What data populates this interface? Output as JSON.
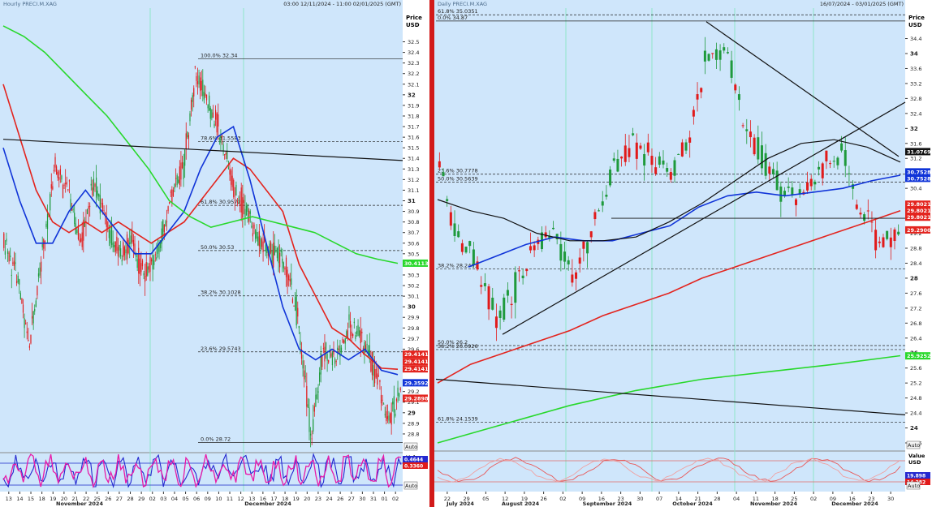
{
  "colors": {
    "bg": "#cfe6fb",
    "axis_bg": "#ffffff",
    "grid": "#8fe5c9",
    "up": "#1f9a3c",
    "down": "#e11a1a",
    "ma_blue": "#1034d8",
    "ma_red": "#e3241e",
    "ma_green": "#28d82b",
    "ma_black": "#111111",
    "ind_blue": "#2428d0",
    "ind_pink": "#e81aa8",
    "stoch": "#e87a7a"
  },
  "left": {
    "title": "Hourly PRECI.M.XAG",
    "time_range": "03:00 12/11/2024 - 11:00 02/01/2025 (GMT)",
    "price_header": [
      "Price",
      "USD"
    ],
    "y_ticks": [
      "32.5",
      "32.4",
      "32.3",
      "32.2",
      "32.1",
      "32",
      "31.9",
      "31.8",
      "31.7",
      "31.6",
      "31.5",
      "31.4",
      "31.3",
      "31.2",
      "31.1",
      "31",
      "30.9",
      "30.8",
      "30.7",
      "30.6",
      "30.5",
      "30.4",
      "30.3",
      "30.2",
      "30.1",
      "30",
      "29.9",
      "29.8",
      "29.7",
      "29.6",
      "29.5",
      "29.4",
      "29.3",
      "29.2",
      "29.1",
      "29",
      "28.9",
      "28.8"
    ],
    "fib_levels": [
      {
        "label": "100.0% 32.34",
        "value": 32.34
      },
      {
        "label": "78.6% 31.5583",
        "value": 31.5583
      },
      {
        "label": "61.8% 30.9572",
        "value": 30.9572
      },
      {
        "label": "50.0% 30.53",
        "value": 30.53
      },
      {
        "label": "38.2% 30.1028",
        "value": 30.1028
      },
      {
        "label": "23.6% 29.5743",
        "value": 29.5743
      },
      {
        "label": "0.0% 28.72",
        "value": 28.72
      }
    ],
    "badges": [
      {
        "text": "30.4113",
        "value": 30.4113,
        "color": "#28d82b"
      },
      {
        "text": "29.4141",
        "value": 29.4141,
        "color": "#e3241e"
      },
      {
        "text": "29.4141",
        "value": 29.4141,
        "color": "#e3241e"
      },
      {
        "text": "29.4141",
        "value": 29.4141,
        "color": "#e3241e"
      },
      {
        "text": "29.3592",
        "value": 29.3592,
        "color": "#1034d8"
      },
      {
        "text": "29.2898",
        "value": 29.2898,
        "color": "#e3241e"
      }
    ],
    "indicator": {
      "header": [
        "Value",
        "USD"
      ],
      "badges": [
        "0.4644",
        "0.3360"
      ],
      "auto_label": "Auto"
    },
    "auto_label": "Auto",
    "x_day_labels": [
      "13",
      "14",
      "15",
      "18",
      "19",
      "20",
      "21",
      "22",
      "25",
      "26",
      "27",
      "28",
      "29",
      "02",
      "03",
      "04",
      "05",
      "06",
      "09",
      "10",
      "11",
      "12",
      "13",
      "16",
      "17",
      "18",
      "19",
      "20",
      "23",
      "24",
      "26",
      "27",
      "30",
      "31",
      "01",
      "02"
    ],
    "x_month_labels": [
      "November 2024",
      "December 2024"
    ]
  },
  "right": {
    "title": "Daily PRECI.M.XAG",
    "time_range": "16/07/2024 - 03/01/2025 (GMT)",
    "price_header": [
      "Price",
      "USD"
    ],
    "y_ticks": [
      "34.4",
      "34",
      "33.6",
      "33.2",
      "32.8",
      "32.4",
      "32",
      "31.6",
      "31.2",
      "30.8",
      "30.4",
      "30",
      "29.6",
      "29.2",
      "28.8",
      "28.4",
      "28",
      "27.6",
      "27.2",
      "26.8",
      "26.4",
      "26",
      "25.6",
      "25.2",
      "24.8",
      "24.4",
      "24",
      "23.6"
    ],
    "fib_levels": [
      {
        "label": "61.8% 35.0351",
        "value": 35.0351
      },
      {
        "label": "0.0% 34.87",
        "value": 34.87
      },
      {
        "label": "23.6% 30.7778",
        "value": 30.7778
      },
      {
        "label": "50.0% 30.5639",
        "value": 30.5639
      },
      {
        "label": "38.2% 28.2461",
        "value": 28.2461
      },
      {
        "label": "50.0% 26.2",
        "value": 26.2
      },
      {
        "label": "38.2% 26.0926",
        "value": 26.0926
      },
      {
        "label": "61.8% 24.1539",
        "value": 24.1539
      }
    ],
    "badges": [
      {
        "text": "31.0769",
        "value": 31.0769,
        "color": "#111111"
      },
      {
        "text": "30.7528",
        "value": 30.7528,
        "color": "#1034d8"
      },
      {
        "text": "30.7528",
        "value": 30.7528,
        "color": "#1034d8"
      },
      {
        "text": "29.8021",
        "value": 29.8021,
        "color": "#e3241e"
      },
      {
        "text": "29.8021",
        "value": 29.8021,
        "color": "#e3241e"
      },
      {
        "text": "29.8021",
        "value": 29.8021,
        "color": "#e3241e"
      },
      {
        "text": "29.2900",
        "value": 29.29,
        "color": "#e3241e"
      },
      {
        "text": "25.9252",
        "value": 25.9252,
        "color": "#28d82b"
      }
    ],
    "indicator": {
      "header": [
        "Value",
        "USD"
      ],
      "badges": [
        "19.898",
        "14.382"
      ],
      "auto_label": "Auto"
    },
    "auto_label": "Auto",
    "x_day_labels": [
      "22",
      "29",
      "05",
      "12",
      "19",
      "26",
      "02",
      "09",
      "16",
      "23",
      "30",
      "07",
      "14",
      "21",
      "28",
      "04",
      "11",
      "18",
      "25",
      "02",
      "09",
      "16",
      "23",
      "30"
    ],
    "x_month_labels": [
      "July 2024",
      "August 2024",
      "September 2024",
      "October 2024",
      "November 2024",
      "December 2024"
    ]
  },
  "chart_data": [
    {
      "type": "line",
      "title": "Hourly PRECI.M.XAG",
      "ylabel": "Price USD",
      "ylim": [
        28.7,
        32.6
      ],
      "x_range": [
        "13 Nov 2024",
        "02 Jan 2025"
      ],
      "series": [
        {
          "values": [
            31.0,
            30.4,
            29.7,
            30.6,
            31.4,
            31.2,
            30.6,
            31.2,
            30.9,
            30.6,
            30.5,
            30.3,
            30.6,
            30.9,
            31.3,
            32.3,
            31.8,
            31.7,
            31.2,
            30.9,
            30.7,
            30.5,
            30.3,
            29.1,
            28.8,
            29.7,
            29.5,
            29.8,
            29.7,
            29.3,
            28.9,
            29.2
          ]
        },
        {
          "values": [
            30.5,
            30.7,
            30.9,
            31.0,
            31.0,
            30.9,
            30.7,
            30.5,
            30.5,
            30.6,
            30.9,
            31.4,
            31.7,
            31.5,
            30.9,
            30.1,
            29.6,
            29.5,
            29.4,
            29.4,
            29.4,
            29.36
          ]
        },
        {
          "values": [
            31.0,
            30.8,
            30.8,
            30.7,
            30.6,
            30.6,
            30.7,
            31.0,
            31.3,
            31.4,
            31.3,
            31.1,
            30.8,
            30.4,
            30.0,
            29.8,
            29.6,
            29.5,
            29.41
          ]
        },
        {
          "values": [
            31.8,
            31.7,
            31.4,
            31.0,
            30.8,
            30.7,
            30.6,
            30.53,
            30.45,
            30.41
          ]
        }
      ],
      "indicator": {
        "type": "line",
        "ylabel": "Value USD",
        "values": [
          0.4644,
          0.336
        ]
      }
    },
    {
      "type": "line",
      "title": "Daily PRECI.M.XAG",
      "ylabel": "Price USD",
      "ylim": [
        23.6,
        34.9
      ],
      "x_range": [
        "22 Jul 2024",
        "30 Dec 2024"
      ],
      "series": [
        {
          "values": [
            31.0,
            29.1,
            28.4,
            26.8,
            28.4,
            29.0,
            29.2,
            28.0,
            29.5,
            30.8,
            31.7,
            31.5,
            30.9,
            31.6,
            34.6,
            33.7,
            31.8,
            31.1,
            30.3,
            30.2,
            31.0,
            31.7,
            29.8,
            28.9,
            29.29
          ]
        },
        {
          "values": [
            28.2,
            28.4,
            28.8,
            29.1,
            29.0,
            29.0,
            29.3,
            29.5,
            29.8,
            30.2,
            30.3,
            30.2,
            30.3,
            30.5,
            30.75
          ]
        },
        {
          "values": [
            25.3,
            26.1,
            26.6,
            27.1,
            27.6,
            28.1,
            28.6,
            29.0,
            29.4,
            29.8
          ]
        },
        {
          "values": [
            23.4,
            24.0,
            24.7,
            25.2,
            25.6,
            25.93
          ]
        },
        {
          "values": [
            30.2,
            29.6,
            29.2,
            29.5,
            30.4,
            30.6,
            31.1,
            31.6,
            31.4,
            31.08
          ]
        }
      ],
      "indicator": {
        "type": "line",
        "ylabel": "Value USD",
        "values": [
          19.898,
          14.382
        ]
      }
    }
  ]
}
